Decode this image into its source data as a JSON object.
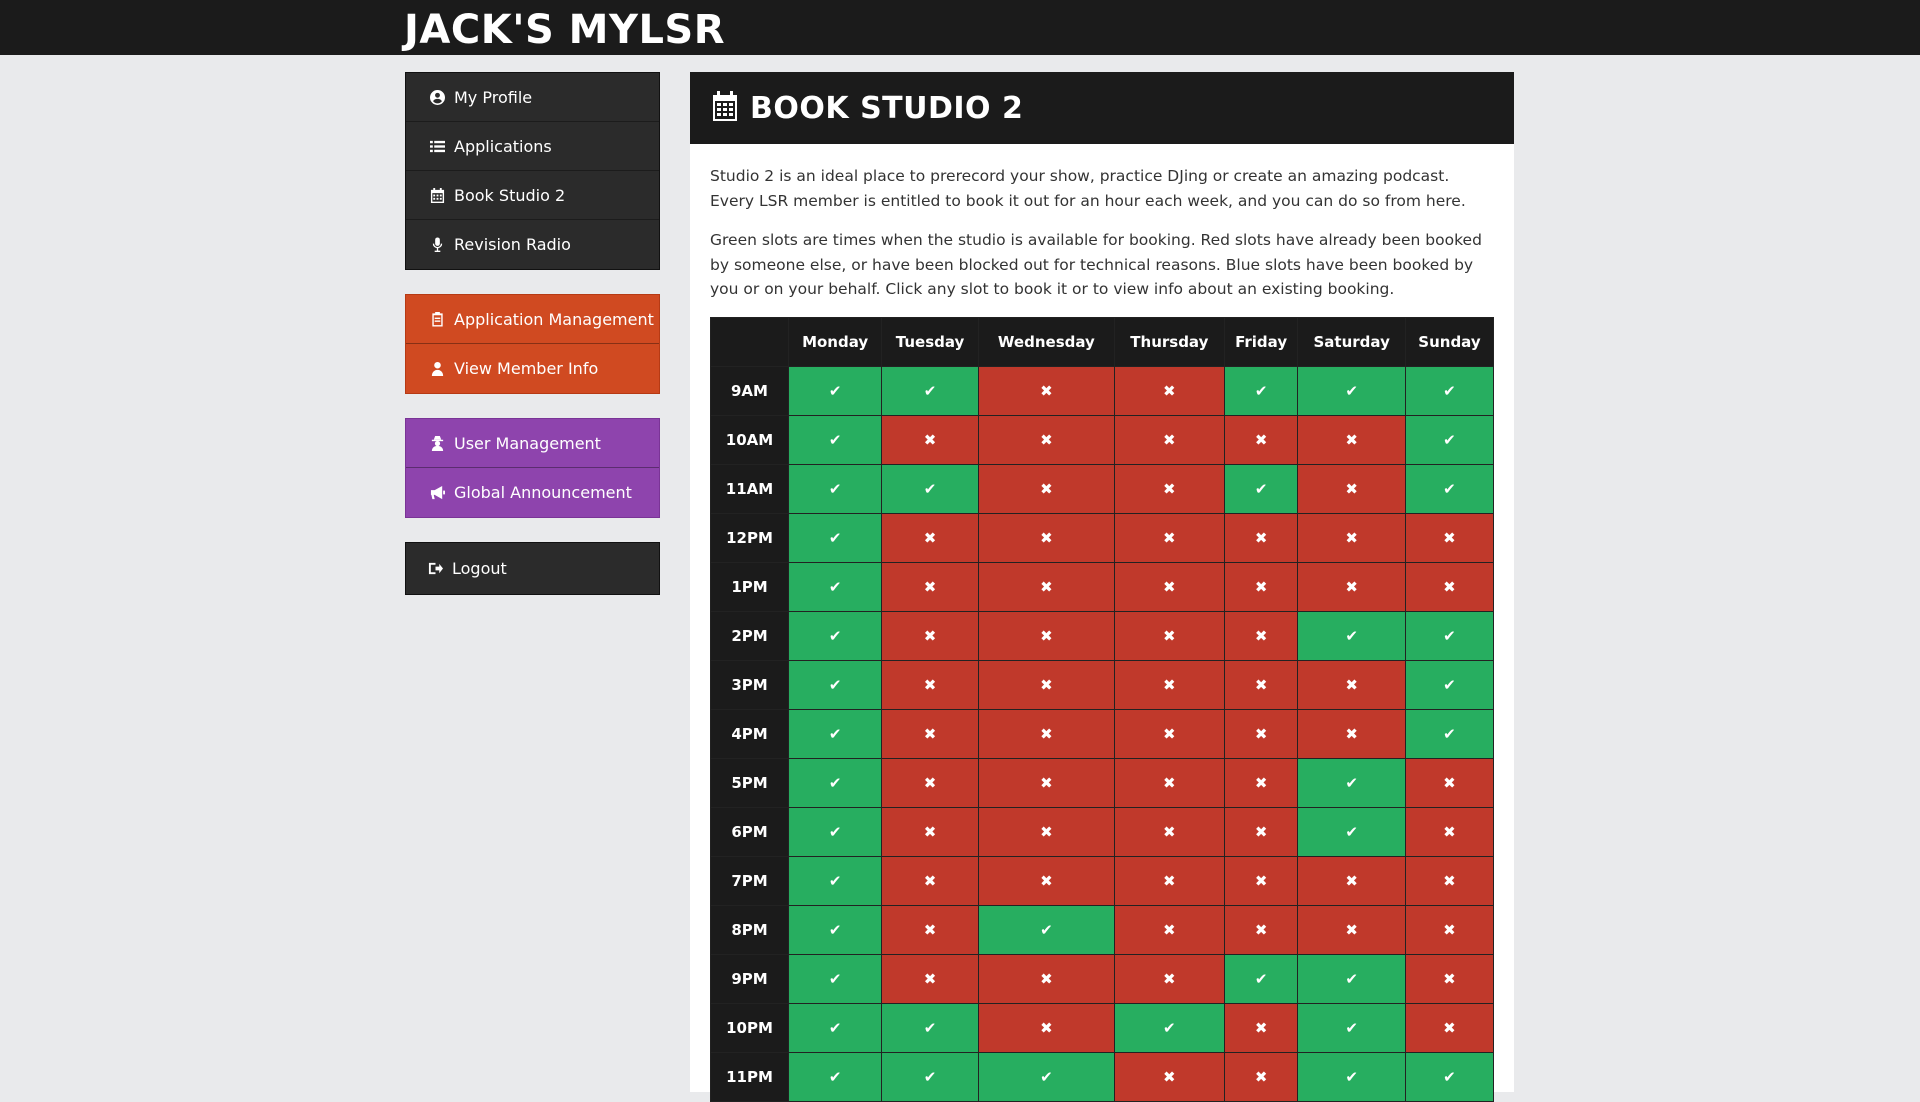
{
  "app": {
    "brand": "JACK'S MYLSR"
  },
  "sidebar": {
    "groups": [
      {
        "style": "dark",
        "items": [
          {
            "icon": "user-circle-icon",
            "label": "My Profile"
          },
          {
            "icon": "list-icon",
            "label": "Applications"
          },
          {
            "icon": "calendar-icon",
            "label": "Book Studio 2"
          },
          {
            "icon": "microphone-icon",
            "label": "Revision Radio"
          }
        ]
      },
      {
        "style": "orange",
        "items": [
          {
            "icon": "clipboard-icon",
            "label": "Application Management"
          },
          {
            "icon": "user-icon",
            "label": "View Member Info"
          }
        ]
      },
      {
        "style": "purple",
        "items": [
          {
            "icon": "user-secret-icon",
            "label": "User Management"
          },
          {
            "icon": "bullhorn-icon",
            "label": "Global Announcement"
          }
        ]
      },
      {
        "style": "logout",
        "items": [
          {
            "icon": "sign-out-icon",
            "label": "Logout"
          }
        ]
      }
    ]
  },
  "page": {
    "title": "BOOK STUDIO 2",
    "title_icon": "calendar-icon",
    "intro": "Studio 2 is an ideal place to prerecord your show, practice DJing or create an amazing podcast. Every LSR member is entitled to book it out for an hour each week, and you can do so from here.",
    "legend_text": "Green slots are times when the studio is available for booking. Red slots have already been booked by someone else, or have been blocked out for technical reasons. Blue slots have been booked by you or on your behalf. Click any slot to book it or to view info about an existing booking."
  },
  "booking": {
    "colors": {
      "available": "#27ae60",
      "taken": "#c0392b",
      "mine": "#2980b9"
    },
    "symbols": {
      "available": "✔",
      "taken": "✖"
    },
    "days": [
      "Monday",
      "Tuesday",
      "Wednesday",
      "Thursday",
      "Friday",
      "Saturday",
      "Sunday"
    ],
    "rows": [
      {
        "time": "9AM",
        "slots": [
          "A",
          "A",
          "T",
          "T",
          "A",
          "A",
          "A"
        ]
      },
      {
        "time": "10AM",
        "slots": [
          "A",
          "T",
          "T",
          "T",
          "T",
          "T",
          "A"
        ]
      },
      {
        "time": "11AM",
        "slots": [
          "A",
          "A",
          "T",
          "T",
          "A",
          "T",
          "A"
        ]
      },
      {
        "time": "12PM",
        "slots": [
          "A",
          "T",
          "T",
          "T",
          "T",
          "T",
          "T"
        ]
      },
      {
        "time": "1PM",
        "slots": [
          "A",
          "T",
          "T",
          "T",
          "T",
          "T",
          "T"
        ]
      },
      {
        "time": "2PM",
        "slots": [
          "A",
          "T",
          "T",
          "T",
          "T",
          "A",
          "A"
        ]
      },
      {
        "time": "3PM",
        "slots": [
          "A",
          "T",
          "T",
          "T",
          "T",
          "T",
          "A"
        ]
      },
      {
        "time": "4PM",
        "slots": [
          "A",
          "T",
          "T",
          "T",
          "T",
          "T",
          "A"
        ]
      },
      {
        "time": "5PM",
        "slots": [
          "A",
          "T",
          "T",
          "T",
          "T",
          "A",
          "T"
        ]
      },
      {
        "time": "6PM",
        "slots": [
          "A",
          "T",
          "T",
          "T",
          "T",
          "A",
          "T"
        ]
      },
      {
        "time": "7PM",
        "slots": [
          "A",
          "T",
          "T",
          "T",
          "T",
          "T",
          "T"
        ]
      },
      {
        "time": "8PM",
        "slots": [
          "A",
          "T",
          "A",
          "T",
          "T",
          "T",
          "T"
        ]
      },
      {
        "time": "9PM",
        "slots": [
          "A",
          "T",
          "T",
          "T",
          "A",
          "A",
          "T"
        ]
      },
      {
        "time": "10PM",
        "slots": [
          "A",
          "A",
          "T",
          "A",
          "T",
          "A",
          "T"
        ]
      },
      {
        "time": "11PM",
        "slots": [
          "A",
          "A",
          "A",
          "T",
          "T",
          "A",
          "A"
        ]
      }
    ]
  }
}
